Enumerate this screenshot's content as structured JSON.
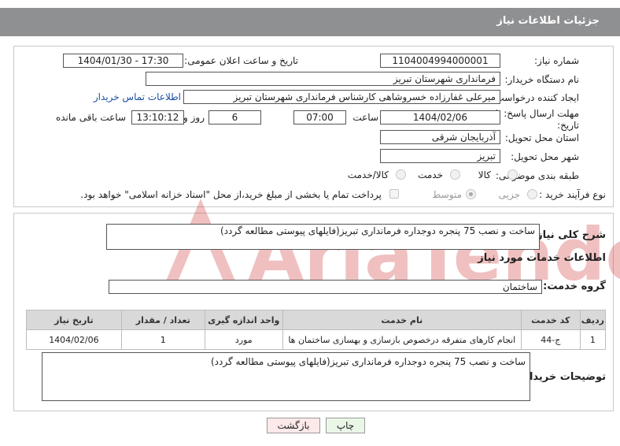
{
  "header": {
    "title": "جزئیات اطلاعات نیاز"
  },
  "info": {
    "need_number_label": "شماره نیاز:",
    "need_number": "1104004994000001",
    "announce_label": "تاریخ و ساعت اعلان عمومی:",
    "announce_value": "1404/01/30 - 17:30",
    "buyer_org_label": "نام دستگاه خریدار:",
    "buyer_org": "فرمانداری شهرستان تبریز",
    "requester_label": "ایجاد کننده درخواست:",
    "requester": "میرعلی غفارزاده خسروشاهی کارشناس فرمانداری شهرستان تبریز",
    "contact_link": "اطلاعات تماس خریدار",
    "deadline_label_1": "مهلت ارسال پاسخ: تا",
    "deadline_label_2": "تاریخ:",
    "deadline_date": "1404/02/06",
    "time_label": "ساعت",
    "deadline_time": "07:00",
    "days_count": "6",
    "days_label": "روز و",
    "remaining_time": "13:10:12",
    "remaining_label": "ساعت باقی مانده",
    "province_label": "استان محل تحویل:",
    "province": "آذربایجان شرقی",
    "city_label": "شهر محل تحویل:",
    "city": "تبریز",
    "category_label": "طبقه بندی موضوعی:",
    "category_options": [
      "کالا",
      "خدمت",
      "کالا/خدمت"
    ],
    "process_label": "نوع فرآیند خرید :",
    "process_options": [
      "جزیی",
      "متوسط"
    ],
    "payment_note": "پرداخت تمام یا بخشی از مبلغ خرید،از محل \"اسناد خزانه اسلامی\" خواهد بود."
  },
  "details": {
    "general_desc_label": "شرح کلی نیاز:",
    "general_desc": "ساخت و نصب 75 پنجره دوجداره فرمانداری تبریز(فایلهای پیوستی مطالعه گردد)",
    "services_title": "اطلاعات خدمات مورد نیاز",
    "service_group_label": "گروه خدمت:",
    "service_group": "ساختمان",
    "table": {
      "headers": [
        "ردیف",
        "کد خدمت",
        "نام خدمت",
        "واحد اندازه گیری",
        "تعداد / مقدار",
        "تاریخ نیاز"
      ],
      "rows": [
        [
          "1",
          "ج-44",
          "انجام کارهای متفرقه درخصوص بازسازی و بهسازی ساختمان ها",
          "مورد",
          "1",
          "1404/02/06"
        ]
      ]
    },
    "buyer_notes_label": "توضیحات خریدار:",
    "buyer_notes": "ساخت و نصب 75 پنجره دوجداره فرمانداری تبریز(فایلهای پیوستی مطالعه گردد)"
  },
  "buttons": {
    "print": "چاپ",
    "back": "بازگشت"
  },
  "watermark_text": "AriaTender.neT",
  "colors": {
    "header_bg": "#8f9092",
    "link": "#1a4fa3",
    "back_btn_bg": "#fde9e9",
    "print_btn_bg": "#eaf7e7",
    "watermark": "#cc2222"
  }
}
